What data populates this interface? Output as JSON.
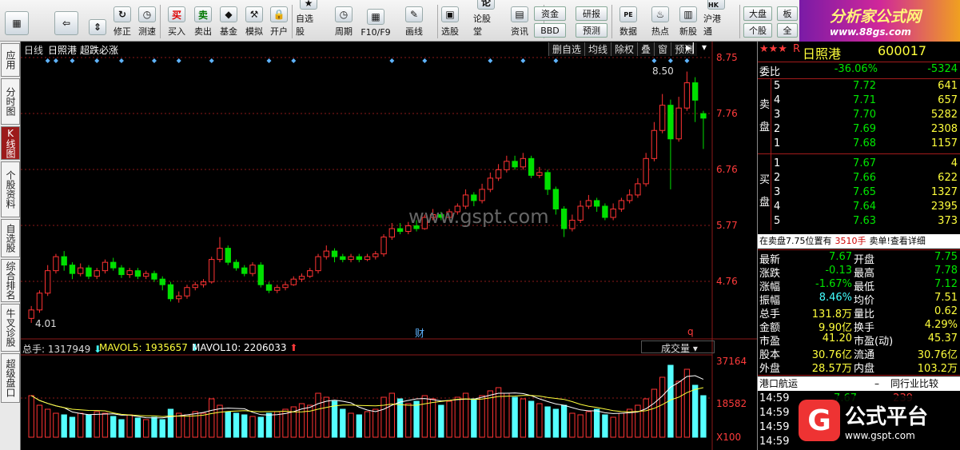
{
  "toolbar": {
    "items": [
      {
        "label": "",
        "icon": "grid-icon"
      },
      {
        "label": "",
        "icon": "back-arrow-icon"
      },
      {
        "label": "",
        "icon": "up-down-icon"
      },
      {
        "label": "修正",
        "icon": "refresh-icon"
      },
      {
        "label": "测速",
        "icon": "clock-icon"
      },
      {
        "label": "买入",
        "icon": "买"
      },
      {
        "label": "卖出",
        "icon": "卖"
      },
      {
        "label": "基金",
        "icon": "fund-icon"
      },
      {
        "label": "模拟",
        "icon": "hammer-icon"
      },
      {
        "label": "开户",
        "icon": "lock-icon"
      },
      {
        "label": "自选股",
        "icon": "star-icon"
      },
      {
        "label": "周期",
        "icon": "clock-icon"
      },
      {
        "label": "F10/F9",
        "icon": "grid-icon"
      },
      {
        "label": "画线",
        "icon": "pen-icon"
      },
      {
        "label": "选股",
        "icon": "screen-icon"
      },
      {
        "label": "论股堂",
        "icon": "论"
      },
      {
        "label": "资讯",
        "icon": "doc-icon"
      },
      {
        "label": "数据",
        "icon": "PE"
      },
      {
        "label": "热点",
        "icon": "fire-icon"
      },
      {
        "label": "新股",
        "icon": "new-icon"
      },
      {
        "label": "沪港通",
        "icon": "SH-HK"
      }
    ],
    "boxes": {
      "zijin": "资金",
      "bbd": "BBD",
      "yanbao": "研报",
      "yuce": "预测",
      "dapan": "大盘",
      "gegu": "个股",
      "ban": "板",
      "quan": "全"
    }
  },
  "brand": {
    "title": "分析家公式网",
    "url": "www.88gs.com",
    "footer_title": "公式平台",
    "footer_url": "www.gspt.com",
    "watermark": "www.gspt.com"
  },
  "left_nav": [
    "应用",
    "分时图",
    "K线图",
    "个股资料",
    "自选股",
    "综合排名",
    "牛叉诊股",
    "超级盘口"
  ],
  "chart": {
    "period": "日线",
    "stock_name": "日照港",
    "formula": "超跌必涨",
    "tools": [
      "删自选",
      "均线",
      "除权",
      "叠",
      "窗",
      "预测"
    ],
    "price_axis": [
      "8.75",
      "7.76",
      "6.76",
      "5.77",
      "4.76"
    ],
    "high_label": "8.50",
    "low_label": "4.01",
    "cai_marker": "财",
    "q_marker": "q",
    "vol_header": {
      "total": "总手: 1317949",
      "mavol5": "MAVOL5: 1935657",
      "mavol10": "MAVOL10: 2206033",
      "select": "成交量"
    },
    "vol_axis": [
      "37164",
      "18582",
      "X100"
    ],
    "colors": {
      "up": "#ff3333",
      "down": "#00e000",
      "grid": "#8b1a1a",
      "signal": "#5fb4ff"
    }
  },
  "chart_data": {
    "type": "candlestick",
    "ylim": [
      4.0,
      8.9
    ],
    "candles": [
      [
        4.1,
        4.25,
        4.32,
        4.02
      ],
      [
        4.25,
        4.55,
        4.6,
        4.2
      ],
      [
        4.55,
        4.95,
        5.05,
        4.5
      ],
      [
        4.95,
        5.2,
        5.25,
        4.9
      ],
      [
        5.2,
        5.05,
        5.3,
        4.95
      ],
      [
        5.05,
        4.9,
        5.1,
        4.8
      ],
      [
        4.9,
        5.0,
        5.08,
        4.85
      ],
      [
        5.0,
        4.85,
        5.05,
        4.8
      ],
      [
        4.85,
        4.95,
        5.0,
        4.8
      ],
      [
        4.95,
        5.1,
        5.15,
        4.9
      ],
      [
        5.1,
        5.0,
        5.18,
        4.95
      ],
      [
        5.0,
        4.88,
        5.05,
        4.82
      ],
      [
        4.88,
        4.95,
        5.0,
        4.82
      ],
      [
        4.95,
        4.85,
        5.0,
        4.8
      ],
      [
        4.85,
        4.9,
        4.95,
        4.8
      ],
      [
        4.9,
        4.8,
        4.95,
        4.75
      ],
      [
        4.8,
        4.7,
        4.85,
        4.6
      ],
      [
        4.7,
        4.45,
        4.75,
        4.4
      ],
      [
        4.45,
        4.5,
        4.58,
        4.38
      ],
      [
        4.5,
        4.65,
        4.7,
        4.45
      ],
      [
        4.65,
        4.7,
        4.75,
        4.6
      ],
      [
        4.7,
        4.75,
        4.8,
        4.65
      ],
      [
        4.75,
        5.15,
        5.2,
        4.72
      ],
      [
        5.15,
        5.35,
        5.55,
        5.1
      ],
      [
        5.35,
        5.1,
        5.4,
        5.05
      ],
      [
        5.1,
        5.0,
        5.15,
        4.95
      ],
      [
        5.0,
        4.9,
        5.05,
        4.85
      ],
      [
        4.9,
        5.05,
        5.1,
        4.85
      ],
      [
        5.05,
        4.7,
        5.1,
        4.65
      ],
      [
        4.7,
        4.6,
        4.75,
        4.55
      ],
      [
        4.6,
        4.65,
        4.7,
        4.55
      ],
      [
        4.65,
        4.7,
        4.75,
        4.6
      ],
      [
        4.7,
        4.8,
        4.85,
        4.68
      ],
      [
        4.8,
        4.85,
        4.9,
        4.75
      ],
      [
        4.85,
        4.95,
        5.0,
        4.82
      ],
      [
        4.95,
        5.2,
        5.25,
        4.9
      ],
      [
        5.2,
        5.3,
        5.4,
        5.15
      ],
      [
        5.3,
        5.2,
        5.35,
        5.1
      ],
      [
        5.2,
        5.15,
        5.25,
        5.1
      ],
      [
        5.15,
        5.2,
        5.25,
        5.1
      ],
      [
        5.2,
        5.15,
        5.25,
        5.1
      ],
      [
        5.15,
        5.2,
        5.25,
        5.12
      ],
      [
        5.2,
        5.25,
        5.3,
        5.15
      ],
      [
        5.25,
        5.55,
        5.6,
        5.2
      ],
      [
        5.55,
        5.7,
        5.8,
        5.5
      ],
      [
        5.7,
        5.65,
        5.8,
        5.6
      ],
      [
        5.65,
        5.75,
        5.82,
        5.6
      ],
      [
        5.75,
        5.7,
        5.85,
        5.65
      ],
      [
        5.7,
        5.9,
        5.95,
        5.68
      ],
      [
        5.9,
        5.95,
        6.05,
        5.85
      ],
      [
        5.95,
        5.9,
        6.0,
        5.85
      ],
      [
        5.9,
        6.0,
        6.05,
        5.85
      ],
      [
        6.0,
        6.1,
        6.15,
        5.95
      ],
      [
        6.1,
        6.3,
        6.4,
        6.05
      ],
      [
        6.3,
        6.2,
        6.35,
        6.1
      ],
      [
        6.2,
        6.4,
        6.5,
        6.15
      ],
      [
        6.4,
        6.6,
        6.7,
        6.35
      ],
      [
        6.6,
        6.75,
        6.85,
        6.55
      ],
      [
        6.75,
        6.9,
        7.0,
        6.7
      ],
      [
        6.9,
        6.8,
        7.0,
        6.75
      ],
      [
        6.8,
        6.95,
        7.05,
        6.75
      ],
      [
        6.95,
        6.65,
        7.0,
        6.6
      ],
      [
        6.65,
        6.7,
        6.8,
        6.6
      ],
      [
        6.7,
        6.4,
        6.75,
        6.3
      ],
      [
        6.4,
        6.05,
        6.45,
        5.95
      ],
      [
        6.05,
        5.7,
        6.1,
        5.55
      ],
      [
        5.7,
        5.85,
        5.95,
        5.65
      ],
      [
        5.85,
        6.1,
        6.2,
        5.8
      ],
      [
        6.1,
        6.2,
        6.3,
        6.05
      ],
      [
        6.2,
        6.1,
        6.25,
        6.0
      ],
      [
        6.1,
        5.9,
        6.15,
        5.85
      ],
      [
        5.9,
        6.05,
        6.15,
        5.85
      ],
      [
        6.05,
        6.2,
        6.25,
        6.0
      ],
      [
        6.2,
        6.3,
        6.4,
        6.15
      ],
      [
        6.3,
        6.5,
        6.6,
        6.25
      ],
      [
        6.5,
        6.95,
        7.05,
        6.45
      ],
      [
        6.95,
        7.45,
        7.6,
        6.9
      ],
      [
        7.45,
        7.9,
        8.1,
        7.4
      ],
      [
        7.9,
        7.3,
        8.0,
        6.4
      ],
      [
        7.3,
        7.85,
        8.05,
        7.25
      ],
      [
        7.85,
        8.3,
        8.5,
        7.8
      ],
      [
        8.3,
        7.99,
        8.4,
        7.6
      ],
      [
        7.75,
        7.67,
        7.8,
        7.12
      ]
    ],
    "volume": [
      52,
      40,
      35,
      30,
      28,
      25,
      30,
      28,
      32,
      30,
      26,
      22,
      28,
      24,
      22,
      25,
      22,
      35,
      30,
      28,
      32,
      30,
      48,
      40,
      32,
      30,
      28,
      26,
      25,
      30,
      32,
      35,
      38,
      42,
      40,
      55,
      50,
      45,
      35,
      30,
      28,
      32,
      35,
      50,
      55,
      48,
      42,
      45,
      52,
      48,
      40,
      45,
      50,
      55,
      48,
      52,
      58,
      62,
      55,
      50,
      48,
      45,
      42,
      38,
      35,
      40,
      30,
      28,
      32,
      35,
      28,
      25,
      30,
      35,
      40,
      48,
      60,
      75,
      90,
      70,
      85,
      65,
      52
    ],
    "volume_unit": "X100"
  },
  "quote": {
    "stars": "★★★",
    "title_prefix": "R",
    "name": "日照港",
    "code": "600017",
    "weibi_label": "委比",
    "weibi": "-36.06%",
    "weicha": "-5324",
    "sell_label": "卖盘",
    "buy_label": "买盘",
    "sells": [
      {
        "lv": "5",
        "price": "7.72",
        "vol": "641"
      },
      {
        "lv": "4",
        "price": "7.71",
        "vol": "657"
      },
      {
        "lv": "3",
        "price": "7.70",
        "vol": "5282"
      },
      {
        "lv": "2",
        "price": "7.69",
        "vol": "2308"
      },
      {
        "lv": "1",
        "price": "7.68",
        "vol": "1157"
      }
    ],
    "buys": [
      {
        "lv": "1",
        "price": "7.67",
        "vol": "4"
      },
      {
        "lv": "2",
        "price": "7.66",
        "vol": "622"
      },
      {
        "lv": "3",
        "price": "7.65",
        "vol": "1327"
      },
      {
        "lv": "4",
        "price": "7.64",
        "vol": "2395"
      },
      {
        "lv": "5",
        "price": "7.63",
        "vol": "373"
      }
    ],
    "status": "在卖盘7.75位置有",
    "status_hand": "3510手",
    "status_tail": "卖单!查看详细",
    "stats": [
      {
        "l1": "最新",
        "v1": "7.67",
        "l2": "开盘",
        "v2": "7.75"
      },
      {
        "l1": "涨跌",
        "v1": "-0.13",
        "l2": "最高",
        "v2": "7.78"
      },
      {
        "l1": "涨幅",
        "v1": "-1.67%",
        "l2": "最低",
        "v2": "7.12"
      },
      {
        "l1": "振幅",
        "v1": "8.46%",
        "l2": "均价",
        "v2": "7.51"
      },
      {
        "l1": "总手",
        "v1": "131.8万",
        "l2": "量比",
        "v2": "0.62"
      },
      {
        "l1": "金额",
        "v1": "9.90亿",
        "l2": "换手",
        "v2": "4.29%"
      },
      {
        "l1": "市盈",
        "v1": "41.20",
        "l2": "市盈(动)",
        "v2": "45.37"
      },
      {
        "l1": "股本",
        "v1": "30.76亿",
        "l2": "流通",
        "v2": "30.76亿"
      },
      {
        "l1": "外盘",
        "v1": "28.57万",
        "l2": "内盘",
        "v2": "103.2万"
      }
    ],
    "industry": "港口航运",
    "industry_dash": "–",
    "compare": "同行业比较",
    "ticks": [
      {
        "time": "14:59",
        "price": "7.67",
        "vol": "239"
      },
      {
        "time": "14:59",
        "price": "",
        "vol": ""
      },
      {
        "time": "14:59",
        "price": "",
        "vol": ""
      },
      {
        "time": "14:59",
        "price": "",
        "vol": ""
      }
    ]
  }
}
